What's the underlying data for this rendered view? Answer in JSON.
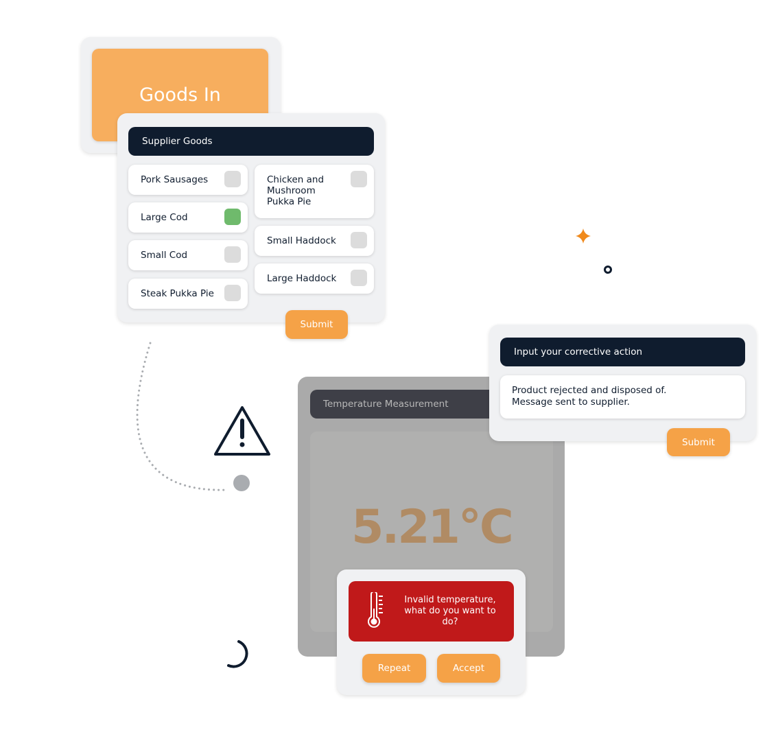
{
  "goods_in": {
    "title": "Goods In"
  },
  "supplier": {
    "header": "Supplier Goods",
    "items_left": [
      {
        "label": "Pork Sausages",
        "checked": false
      },
      {
        "label": "Large Cod",
        "checked": true
      },
      {
        "label": "Small Cod",
        "checked": false
      },
      {
        "label": "Steak Pukka Pie",
        "checked": false
      }
    ],
    "items_right": [
      {
        "label": "Chicken and Mushroom Pukka Pie",
        "checked": false
      },
      {
        "label": "Small Haddock",
        "checked": false
      },
      {
        "label": "Large Haddock",
        "checked": false
      }
    ],
    "submit": "Submit"
  },
  "temperature": {
    "header": "Temperature Measurement",
    "value": "5.21°C"
  },
  "corrective": {
    "header": "Input your corrective action",
    "value_line1": "Product rejected and disposed of.",
    "value_line2": "Message sent to supplier.",
    "submit": "Submit"
  },
  "dialog": {
    "message": "Invalid temperature, what do you want to do?",
    "icon": "thermometer-icon",
    "repeat": "Repeat",
    "accept": "Accept"
  },
  "colors": {
    "accent": "#f5a247",
    "navy": "#0f1c2e",
    "alert": "#c0191a",
    "checked": "#6fba6c"
  }
}
